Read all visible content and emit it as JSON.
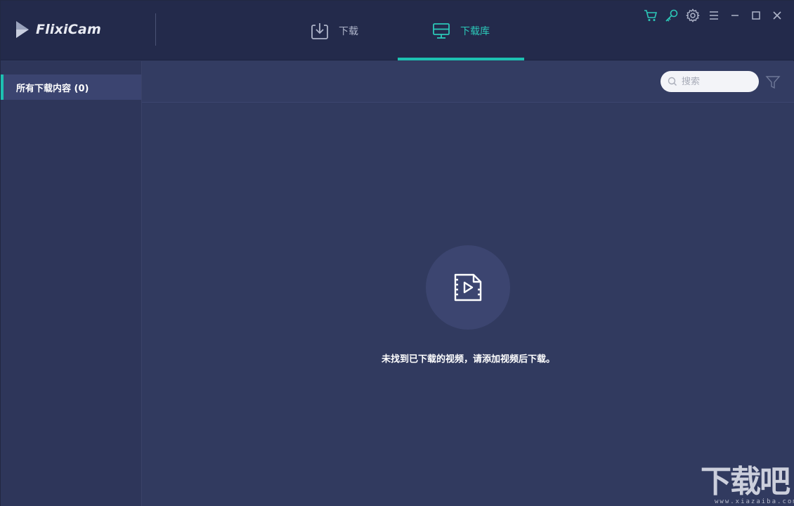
{
  "app": {
    "name": "FlixiCam"
  },
  "tabs": [
    {
      "label": "下载",
      "icon": "download-tray-icon",
      "active": false
    },
    {
      "label": "下载库",
      "icon": "monitor-library-icon",
      "active": true
    }
  ],
  "window_controls": [
    "cart-icon",
    "key-icon",
    "gear-icon",
    "menu-icon",
    "minimize-icon",
    "maximize-icon",
    "close-icon"
  ],
  "sidebar": {
    "items": [
      {
        "label": "所有下载内容 (0)",
        "active": true
      }
    ]
  },
  "toolbar": {
    "search": {
      "placeholder": "搜索",
      "value": ""
    },
    "filter_icon": "filter-icon"
  },
  "empty_state": {
    "icon": "video-file-icon",
    "message": "未找到已下载的视频，请添加视频后下载。"
  },
  "watermark": {
    "text": "下载吧",
    "sub": "www.xiazaiba.com"
  },
  "colors": {
    "accent": "#1dc1b2",
    "titlebar": "#232a4b",
    "background": "#313a5f",
    "sidebar": "#2e365a"
  }
}
